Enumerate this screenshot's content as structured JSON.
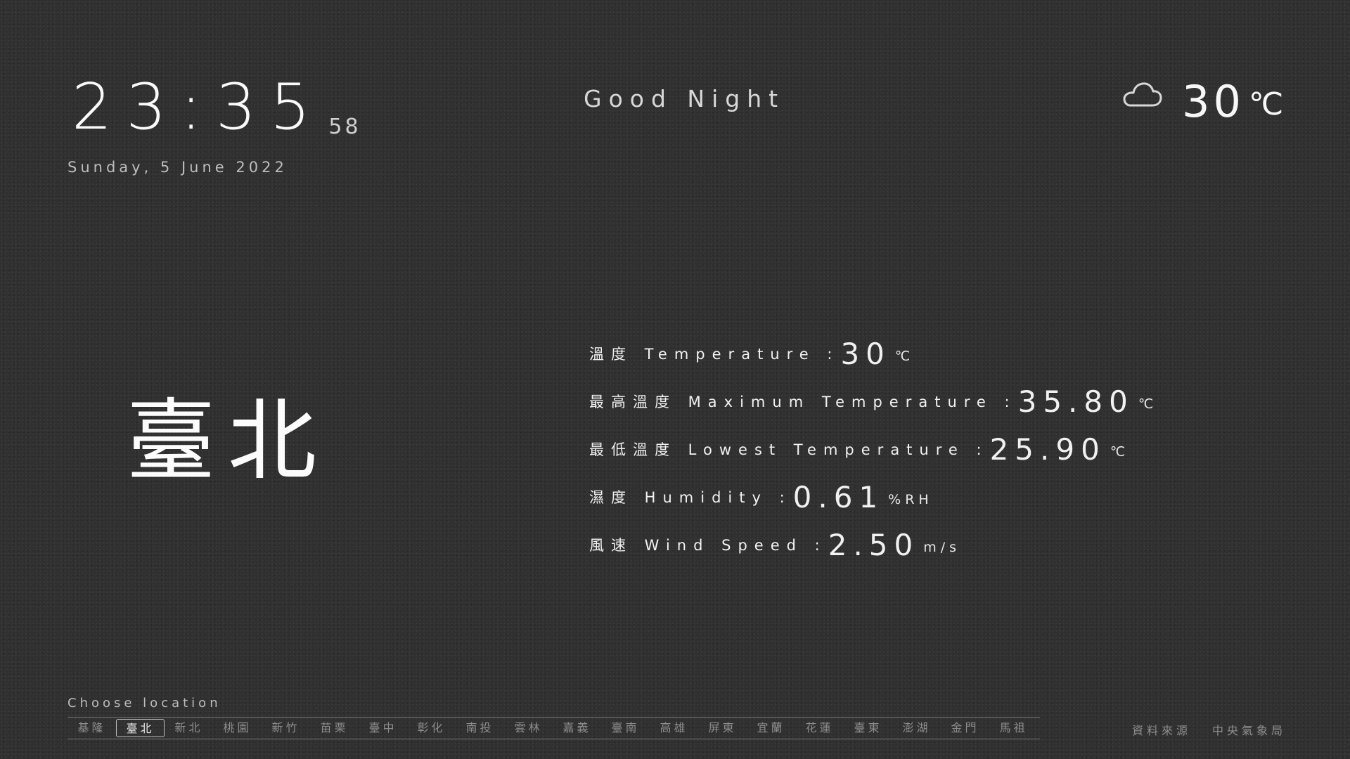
{
  "clock": {
    "time": "23:35",
    "seconds": "58",
    "date": "Sunday, 5 June 2022"
  },
  "greeting": "Good Night",
  "weather": {
    "icon": "cloud-icon",
    "current_temp": "30",
    "unit": "℃"
  },
  "city": "臺北",
  "stats": [
    {
      "label": "溫度 Temperature :",
      "value": "30",
      "unit": "℃"
    },
    {
      "label": "最高溫度 Maximum Temperature :",
      "value": "35.80",
      "unit": "℃"
    },
    {
      "label": "最低溫度 Lowest Temperature :",
      "value": "25.90",
      "unit": "℃"
    },
    {
      "label": "濕度 Humidity :",
      "value": "0.61",
      "unit": "%RH"
    },
    {
      "label": "風速 Wind Speed :",
      "value": "2.50",
      "unit": "m/s"
    }
  ],
  "footer": {
    "choose_label": "Choose location",
    "locations": [
      "基隆",
      "臺北",
      "新北",
      "桃園",
      "新竹",
      "苗栗",
      "臺中",
      "彰化",
      "南投",
      "雲林",
      "嘉義",
      "臺南",
      "高雄",
      "屏東",
      "宜蘭",
      "花蓮",
      "臺東",
      "澎湖",
      "金門",
      "馬祖"
    ],
    "selected": "臺北",
    "source_label": "資料來源",
    "source_name": "中央氣象局"
  }
}
